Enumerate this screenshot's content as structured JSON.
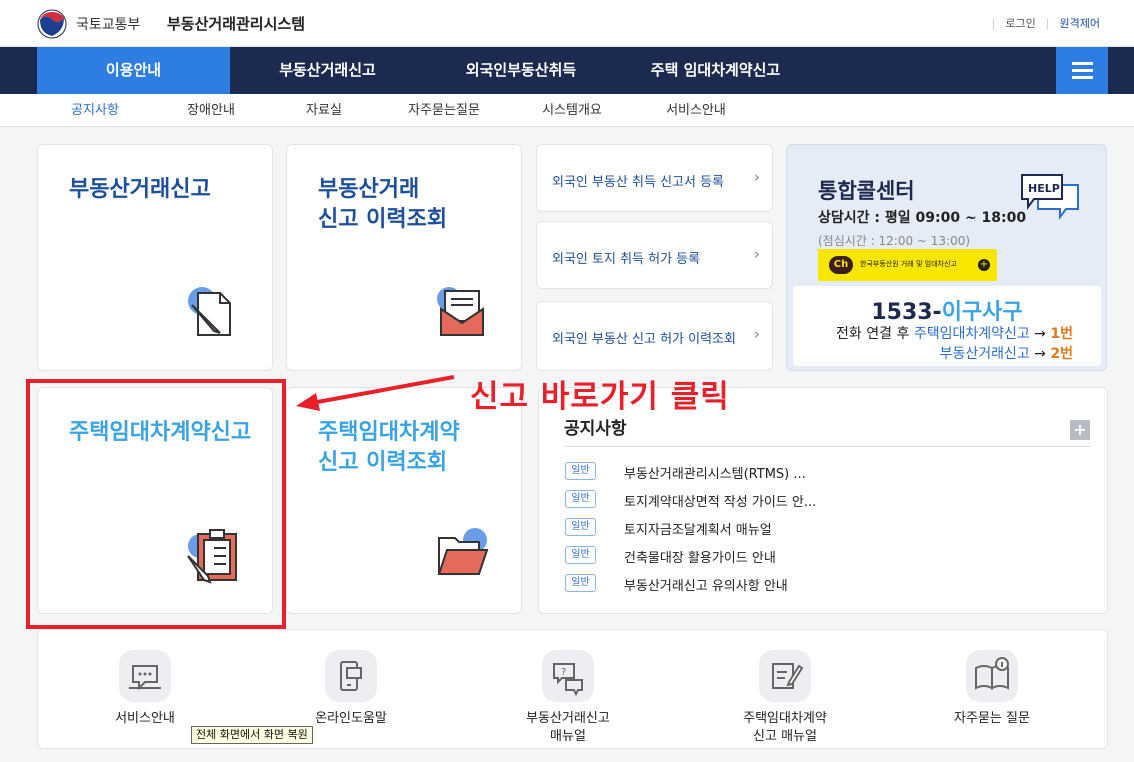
{
  "header": {
    "ministry": "국토교통부",
    "system_name": "부동산거래관리시스템",
    "login": "로그인",
    "remote": "원격제어"
  },
  "main_nav": [
    {
      "label": "이용안내",
      "active": true
    },
    {
      "label": "부동산거래신고",
      "active": false
    },
    {
      "label": "외국인부동산취득",
      "active": false
    },
    {
      "label": "주택 임대차계약신고",
      "active": false
    }
  ],
  "sub_nav": [
    {
      "label": "공지사항",
      "active": true
    },
    {
      "label": "장애안내",
      "active": false
    },
    {
      "label": "자료실",
      "active": false
    },
    {
      "label": "자주묻는질문",
      "active": false
    },
    {
      "label": "시스템개요",
      "active": false
    },
    {
      "label": "서비스안내",
      "active": false
    }
  ],
  "cards": {
    "report": "부동산거래신고",
    "history_line1": "부동산거래",
    "history_line2": "신고 이력조회",
    "lease_report": "주택임대차계약신고",
    "lease_history_line1": "주택임대차계약",
    "lease_history_line2": "신고 이력조회"
  },
  "foreign_links": [
    "외국인 부동산 취득 신고서 등록",
    "외국인 토지 취득 허가 등록",
    "외국인 부동산 신고 허가 이력조회"
  ],
  "callcenter": {
    "title": "통합콜센터",
    "hours": "상담시간 : 평일 09:00 ~ 18:00",
    "lunch": "(점심시간 : 12:00 ~ 13:00)",
    "kakao_badge": "Ch",
    "kakao_text": "한국부동산원 거래 및 임대차신고",
    "phone_number": "1533-",
    "phone_word": "이구사구",
    "route1_prefix": "전화 연결 후 ",
    "route1_name": "주택임대차계약신고",
    "route1_arrow": " → ",
    "route1_num": "1번",
    "route2_name": "부동산거래신고",
    "route2_arrow": " → ",
    "route2_num": "2번"
  },
  "annotation": "신고 바로가기 클릭",
  "notice": {
    "title": "공지사항",
    "more": "+",
    "items": [
      {
        "badge": "일반",
        "text": "부동산거래관리시스템(RTMS) ..."
      },
      {
        "badge": "일반",
        "text": "토지계약대상면적 작성 가이드 안..."
      },
      {
        "badge": "일반",
        "text": "토지자금조달계획서 매뉴얼"
      },
      {
        "badge": "일반",
        "text": "건축물대장 활용가이드 안내"
      },
      {
        "badge": "일반",
        "text": "부동산거래신고 유의사항 안내"
      }
    ]
  },
  "quick_links": [
    {
      "line1": "서비스안내",
      "line2": ""
    },
    {
      "line1": "온라인도움말",
      "line2": ""
    },
    {
      "line1": "부동산거래신고",
      "line2": "매뉴얼"
    },
    {
      "line1": "주택임대차계약",
      "line2": "신고 매뉴얼"
    },
    {
      "line1": "자주묻는 질문",
      "line2": ""
    }
  ],
  "tooltip": "전체 화면에서 화면 복원",
  "colors": {
    "nav_bg": "#1d2a4f",
    "accent": "#2d7de3",
    "title_blue": "#1d4f9c",
    "light_blue": "#3aa3e3",
    "annotation_red": "#e8202a"
  }
}
